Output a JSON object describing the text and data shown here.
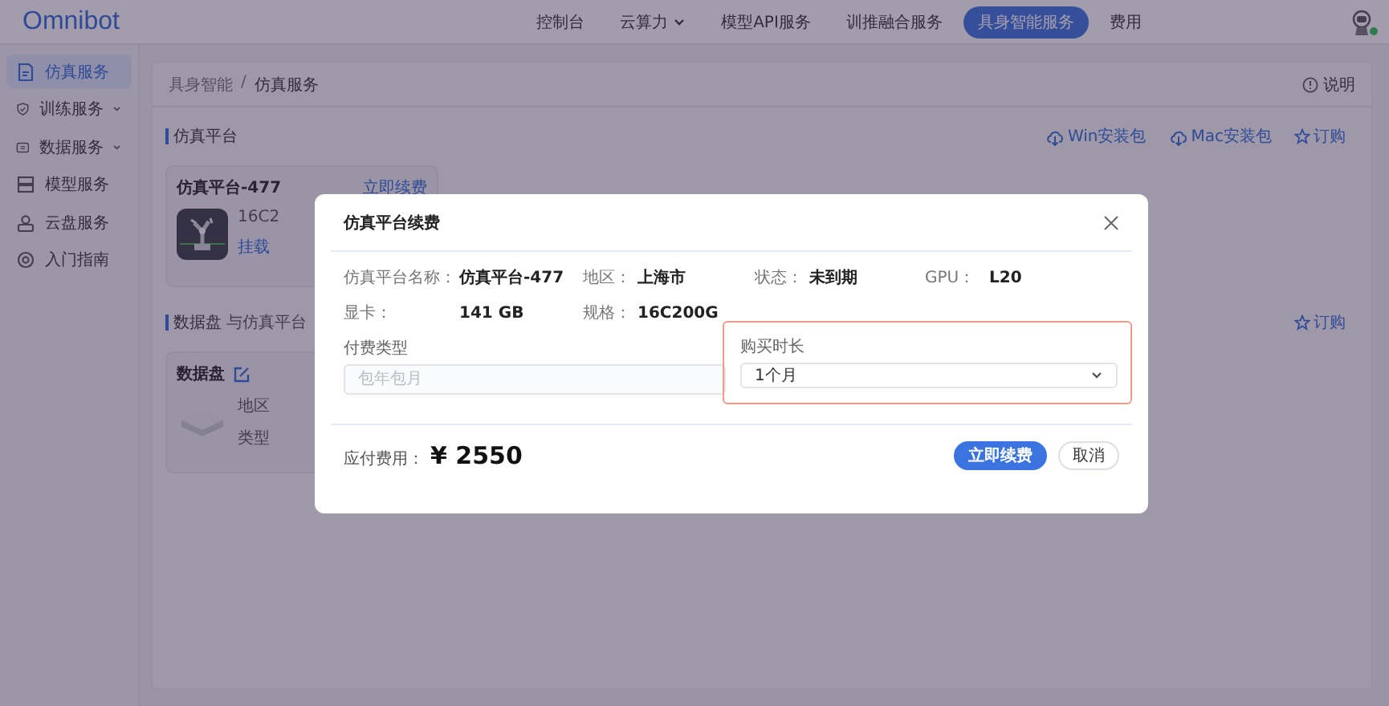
{
  "brand": {
    "logo": "Omnibot"
  },
  "nav": [
    {
      "label": "控制台",
      "selected": false,
      "dropdown": false
    },
    {
      "label": "云算力",
      "selected": false,
      "dropdown": true
    },
    {
      "label": "模型API服务",
      "selected": false,
      "dropdown": false
    },
    {
      "label": "训推融合服务",
      "selected": false,
      "dropdown": false
    },
    {
      "label": "具身智能服务",
      "selected": true,
      "dropdown": false
    },
    {
      "label": "费用",
      "selected": false,
      "dropdown": false
    }
  ],
  "user": {
    "online": true
  },
  "sidebar": {
    "items": [
      {
        "label": "仿真服务",
        "selected": true,
        "expandable": false
      },
      {
        "label": "训练服务",
        "selected": false,
        "expandable": true
      },
      {
        "label": "数据服务",
        "selected": false,
        "expandable": true
      },
      {
        "label": "模型服务",
        "selected": false,
        "expandable": false
      },
      {
        "label": "云盘服务",
        "selected": false,
        "expandable": false
      },
      {
        "label": "入门指南",
        "selected": false,
        "expandable": false
      }
    ]
  },
  "breadcrumb": {
    "items": [
      "具身智能",
      "仿真服务"
    ],
    "separator": "/"
  },
  "help": {
    "label": "说明"
  },
  "sections": [
    {
      "title": "仿真平台",
      "actions": [
        {
          "label": "Win安装包",
          "kind": "download"
        },
        {
          "label": "Mac安装包",
          "kind": "download"
        },
        {
          "label": "订购",
          "kind": "subscribe"
        }
      ],
      "card": {
        "kind": "platform",
        "title": "仿真平台-477",
        "editable": false,
        "action": "立即续费",
        "lines": [
          "16C2",
          "挂载"
        ]
      }
    },
    {
      "title": "数据盘",
      "subtitle": "与仿真平台",
      "actions": [
        {
          "label": "订购",
          "kind": "subscribe"
        }
      ],
      "card": {
        "kind": "disk",
        "title": "数据盘",
        "editable": true,
        "lines": [
          "地区",
          "类型"
        ]
      }
    }
  ],
  "modal": {
    "title": "仿真平台续费",
    "info": [
      {
        "label": "仿真平台名称：",
        "value": "仿真平台-477"
      },
      {
        "label": "地区：",
        "value": "上海市"
      },
      {
        "label": "状态：",
        "value": "未到期"
      },
      {
        "label": "GPU：",
        "value": "L20"
      },
      {
        "label": "显卡：",
        "value": "141 GB"
      },
      {
        "label": "规格：",
        "value": "16C200G"
      }
    ],
    "fields": [
      {
        "label": "付费类型",
        "placeholder": "包年包月",
        "disabled": true,
        "highlighted": false,
        "dropdown": false
      },
      {
        "label": "购买时长",
        "value": "1个月",
        "disabled": false,
        "highlighted": true,
        "dropdown": true
      }
    ],
    "total": {
      "label": "应付费用：",
      "currency": "¥",
      "amount": "2550"
    },
    "buttons": [
      {
        "label": "立即续费",
        "primary": true
      },
      {
        "label": "取消",
        "primary": false
      }
    ]
  }
}
